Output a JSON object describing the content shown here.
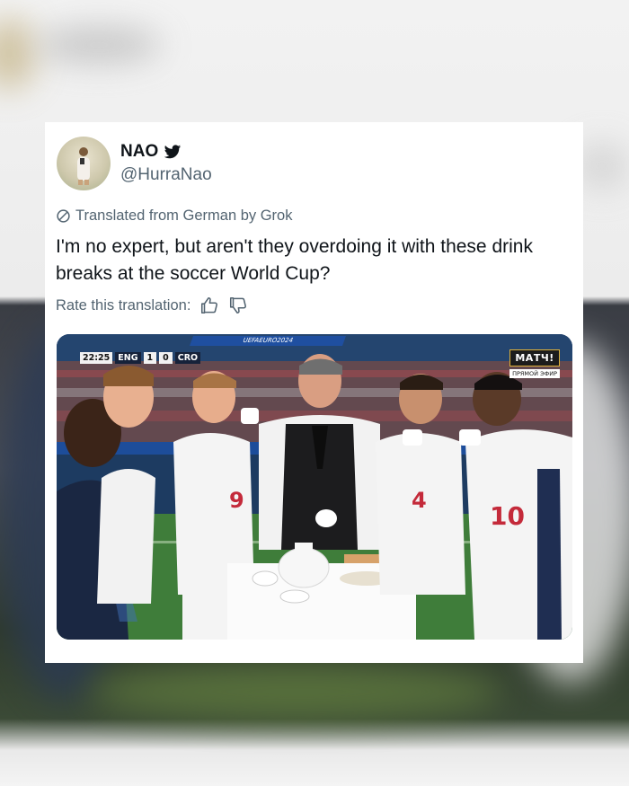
{
  "author": {
    "display_name": "NAO",
    "handle": "@HurraNao"
  },
  "translation_notice": "Translated from German by Grok",
  "tweet_text": "I'm no expert, but aren't they overdoing it with these drink breaks at the soccer World Cup?",
  "rate_label": "Rate this translation:",
  "photo": {
    "scoreboard": {
      "time": "22:25",
      "team_home": "ENG",
      "home_score": "1",
      "away_score": "0",
      "team_away": "CRO"
    },
    "banner_text": "UEFAEURO2024",
    "channel_logo": "МАТЧ!",
    "channel_sub": "ПРЯМОЙ ЭФИР",
    "shirt_numbers": [
      "9",
      "4",
      "10"
    ]
  },
  "colors": {
    "text_primary": "#0f1419",
    "text_secondary": "#536471",
    "card_bg": "#ffffff"
  },
  "icons": {
    "verified": "bird-icon",
    "translate": "slash-circle-icon",
    "like": "thumbs-up-icon",
    "dislike": "thumbs-down-icon"
  }
}
